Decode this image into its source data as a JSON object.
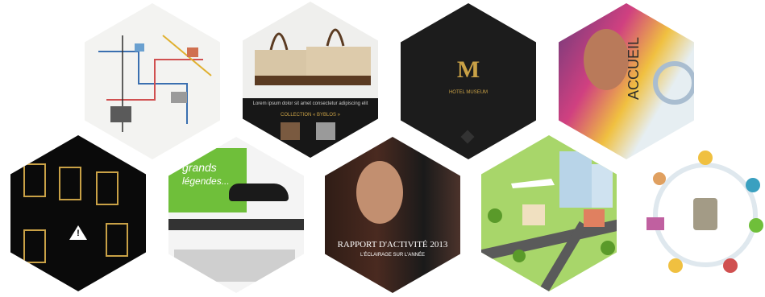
{
  "gallery": {
    "items": [
      {
        "id": "map",
        "text": ""
      },
      {
        "id": "bags",
        "caption": "Lorem ipsum dolor sit amet consectetur adipiscing elit",
        "subcaption": "COLLECTION « BYBLOS »"
      },
      {
        "id": "logo",
        "text": "M",
        "tagline": "HOTEL MUSEUM"
      },
      {
        "id": "accueil",
        "text": "ACCUEIL"
      },
      {
        "id": "flow",
        "text": "!"
      },
      {
        "id": "car",
        "title": "grands",
        "subtitle": "légendes..."
      },
      {
        "id": "rapport",
        "title": "RAPPORT D'ACTIVITÉ 2013",
        "subtitle": "L'ÉCLAIRAGE SUR L'ANNÉE"
      },
      {
        "id": "city",
        "text": ""
      },
      {
        "id": "cycle",
        "text": ""
      }
    ]
  },
  "colors": {
    "background": "#ffffff",
    "gold": "#c9a146",
    "green": "#6fbf3a",
    "dark": "#141414"
  }
}
